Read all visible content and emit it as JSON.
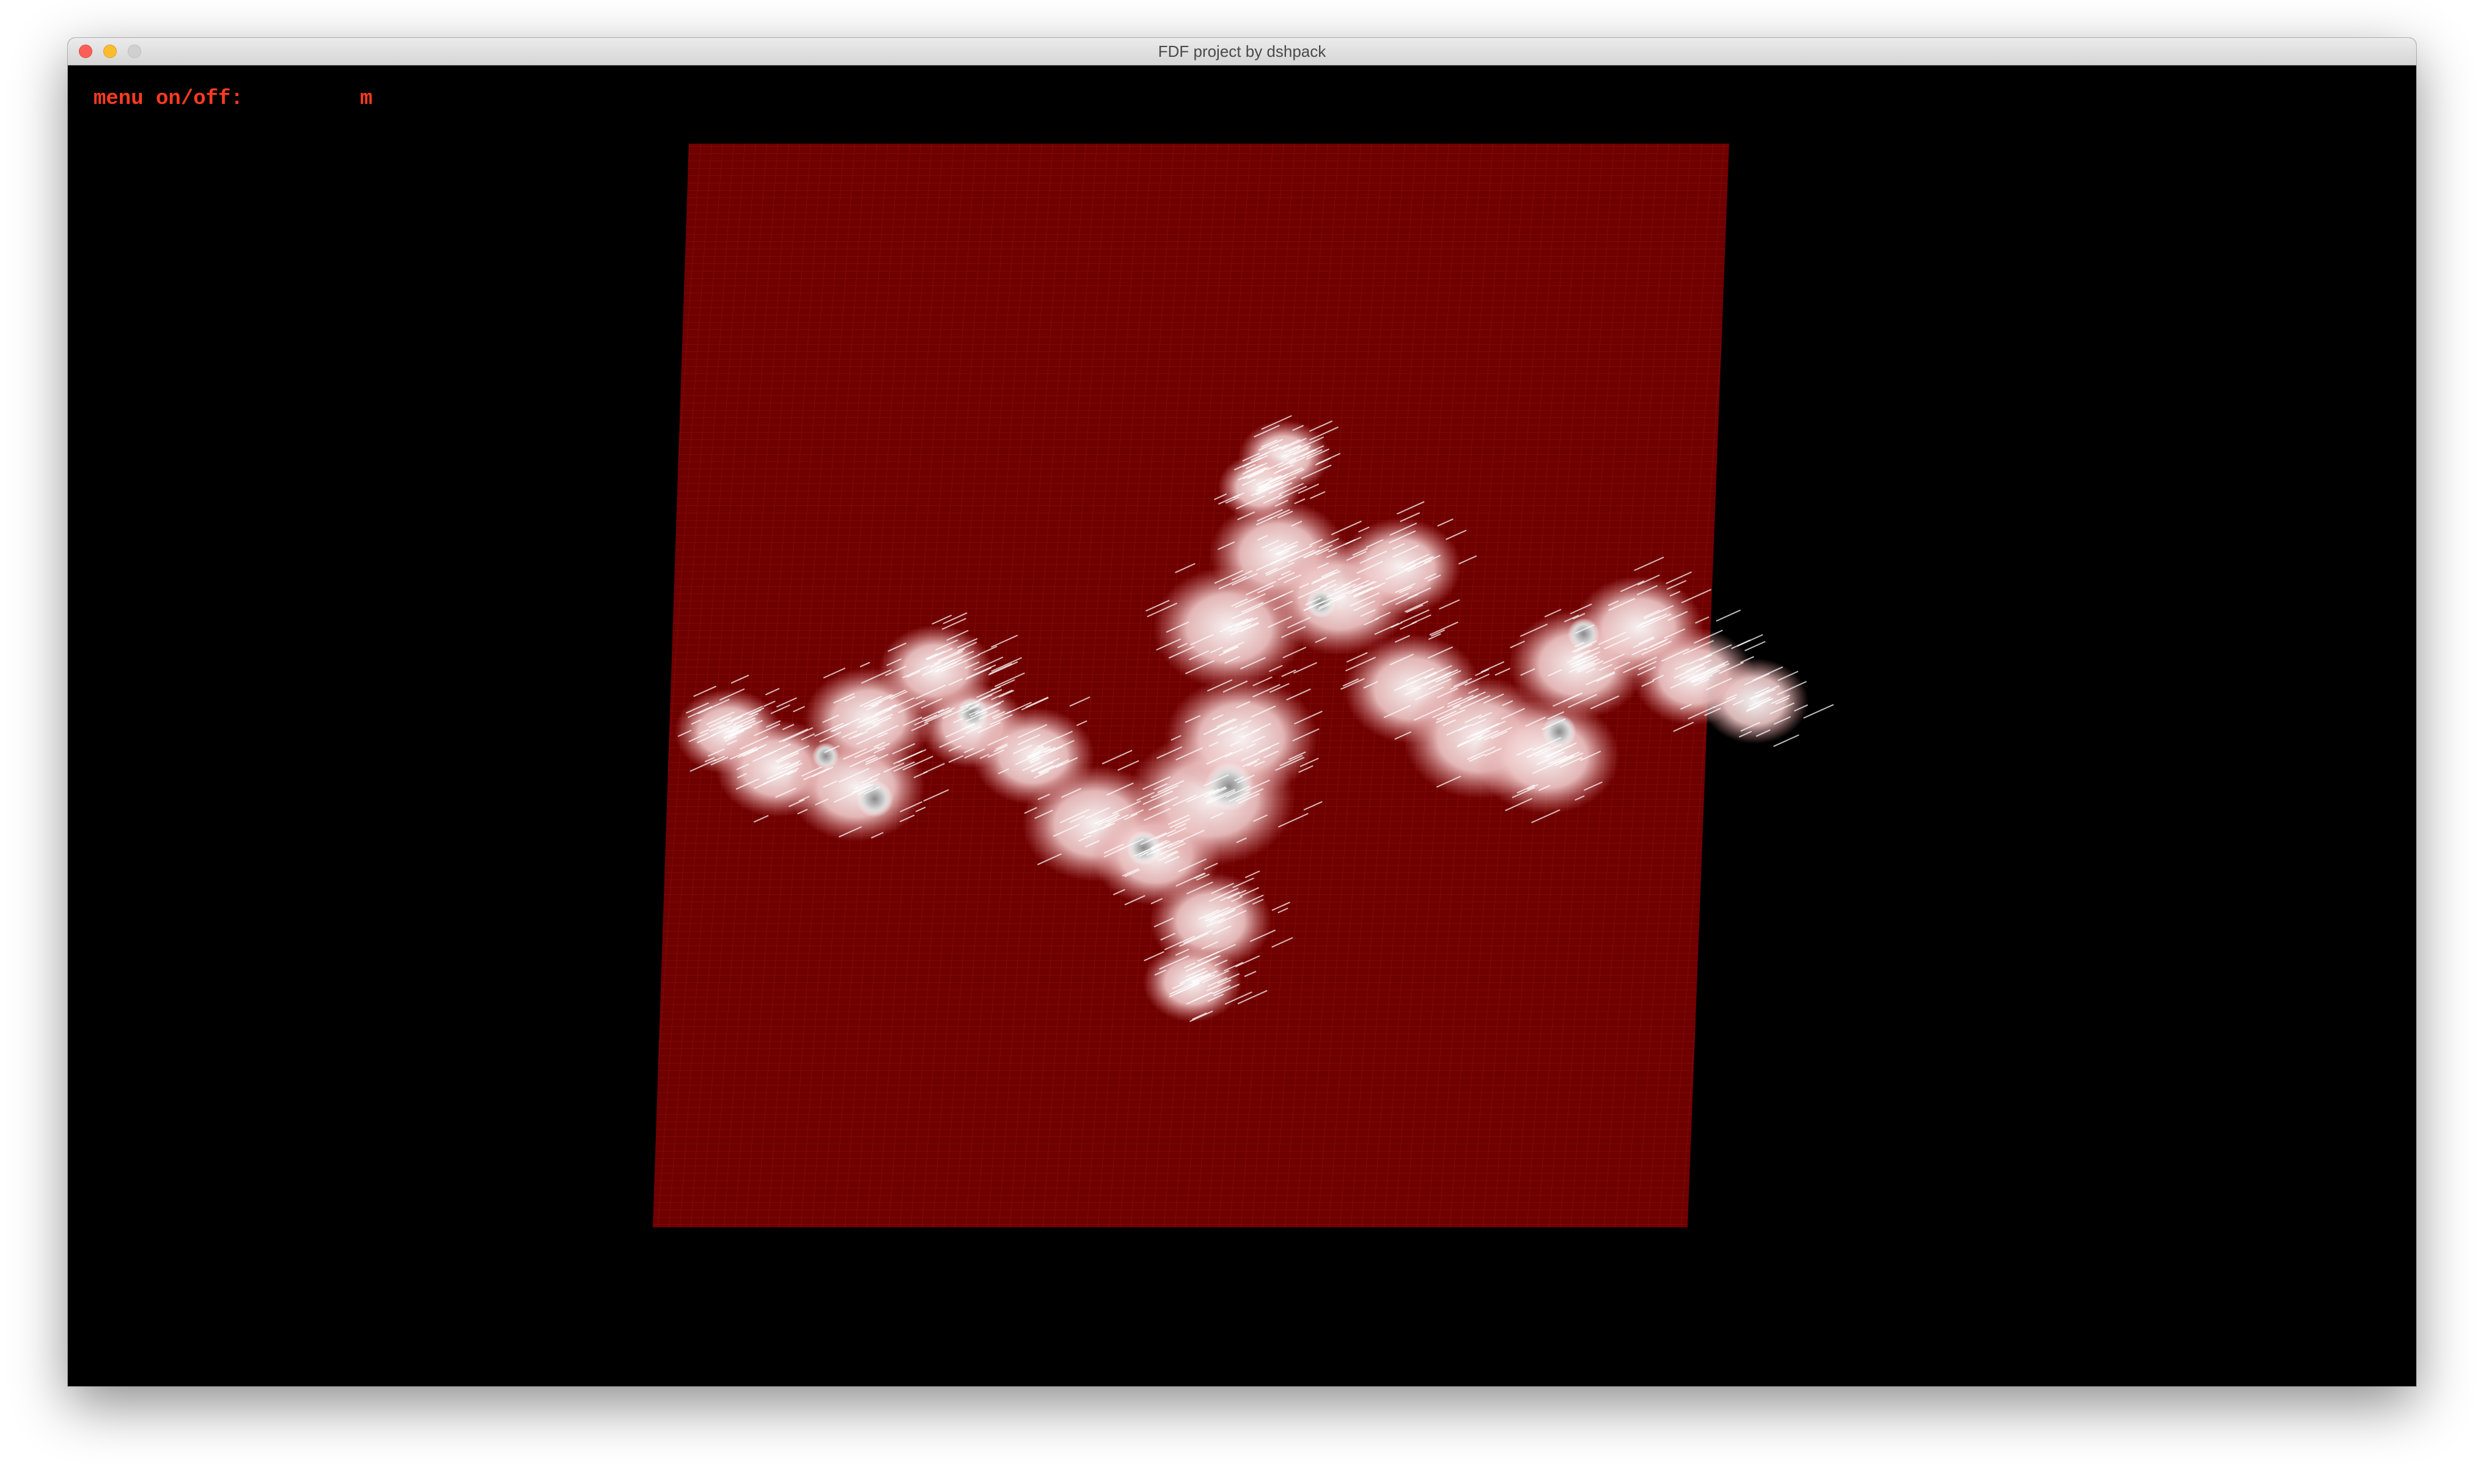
{
  "window": {
    "title": "FDF project by dshpack",
    "controls": [
      "close",
      "minimize",
      "zoom"
    ]
  },
  "hud": {
    "menu_label": "menu on/off:",
    "menu_key": "m"
  },
  "render": {
    "plane_color": "#6e0000",
    "grid_color": "#8a0c0c",
    "fractal_color": "#f2d6d6",
    "fractal_shadow": "#2a2a2a"
  }
}
